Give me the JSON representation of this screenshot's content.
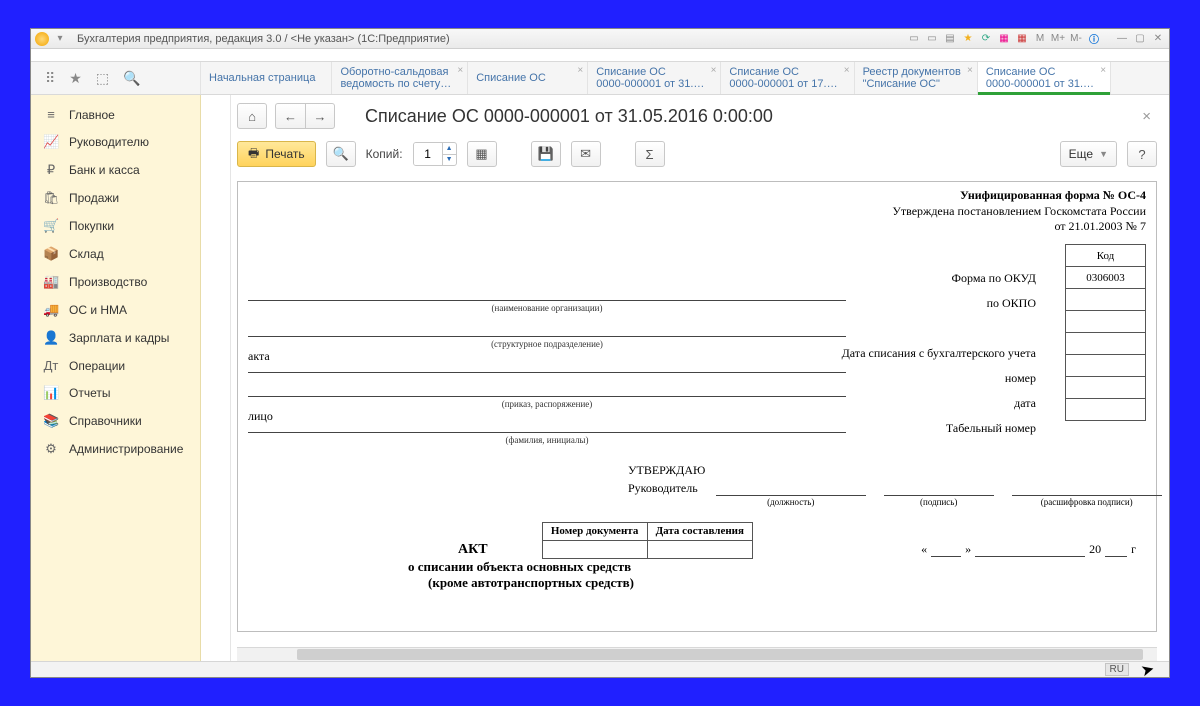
{
  "window": {
    "title": "Бухгалтерия предприятия, редакция 3.0 / <Не указан>  (1С:Предприятие)"
  },
  "tabs": [
    {
      "l1": "Начальная страница",
      "l2": ""
    },
    {
      "l1": "Оборотно-сальдовая",
      "l2": "ведомость по счету…"
    },
    {
      "l1": "Списание ОС",
      "l2": ""
    },
    {
      "l1": "Списание ОС",
      "l2": "0000-000001 от 31.…"
    },
    {
      "l1": "Списание ОС",
      "l2": "0000-000001 от 17.…"
    },
    {
      "l1": "Реестр документов",
      "l2": "\"Списание ОС\""
    },
    {
      "l1": "Списание ОС",
      "l2": "0000-000001 от 31.…"
    }
  ],
  "sidebar": {
    "items": [
      {
        "icon": "≡",
        "label": "Главное"
      },
      {
        "icon": "📈",
        "label": "Руководителю"
      },
      {
        "icon": "₽",
        "label": "Банк и касса"
      },
      {
        "icon": "🛍",
        "label": "Продажи"
      },
      {
        "icon": "🛒",
        "label": "Покупки"
      },
      {
        "icon": "📦",
        "label": "Склад"
      },
      {
        "icon": "🏭",
        "label": "Производство"
      },
      {
        "icon": "🚚",
        "label": "ОС и НМА"
      },
      {
        "icon": "👤",
        "label": "Зарплата и кадры"
      },
      {
        "icon": "Дт",
        "label": "Операции"
      },
      {
        "icon": "📊",
        "label": "Отчеты"
      },
      {
        "icon": "📚",
        "label": "Справочники"
      },
      {
        "icon": "⚙",
        "label": "Администрирование"
      }
    ]
  },
  "doc": {
    "title": "Списание ОС 0000-000001 от 31.05.2016 0:00:00"
  },
  "toolbar": {
    "print": "Печать",
    "copies_label": "Копий:",
    "copies_value": "1",
    "more": "Еще",
    "help": "?"
  },
  "form": {
    "title": "Унифицированная форма № ОС-4",
    "approved": "Утверждена постановлением Госкомстата России",
    "approved2": "от 21.01.2003 № 7",
    "code_header": "Код",
    "code_value": "0306003",
    "labels": {
      "okud": "Форма по ОКУД",
      "okpo": "по ОКПО",
      "write_off_date": "Дата списания с бухгалтерского учета",
      "number": "номер",
      "date": "дата",
      "tab_number": "Табельный номер"
    },
    "captions": {
      "org": "(наименование организации)",
      "dept": "(структурное подразделение)",
      "order": "(приказ, распоряжение)",
      "fio": "(фамилия, инициалы)",
      "position": "(должность)",
      "sign": "(подпись)",
      "decoded": "(расшифровка подписи)"
    },
    "left_fragments": {
      "akta": "акта",
      "lico": "лицо"
    },
    "approve_title": "УТВЕРЖДАЮ",
    "approve_role": "Руководитель",
    "akt_title": "АКТ",
    "num_col1": "Номер документа",
    "num_col2": "Дата составления",
    "date_markers": {
      "open": "«",
      "close": "»",
      "year": "20",
      "g": "г"
    },
    "sub1": "о списании объекта основных средств",
    "sub2": "(кроме автотранспортных средств)"
  },
  "status": {
    "lang": "RU"
  }
}
